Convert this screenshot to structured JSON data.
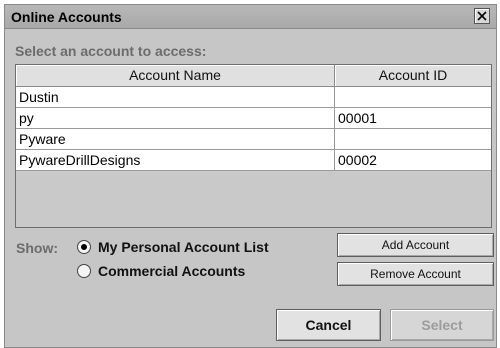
{
  "window": {
    "title": "Online Accounts"
  },
  "prompt": "Select an account to access:",
  "table": {
    "columns": [
      "Account Name",
      "Account ID"
    ],
    "rows": [
      {
        "name": "Dustin",
        "id": ""
      },
      {
        "name": "py",
        "id": "00001"
      },
      {
        "name": "Pyware",
        "id": ""
      },
      {
        "name": "PywareDrillDesigns",
        "id": "00002"
      }
    ]
  },
  "show": {
    "label": "Show:",
    "options": [
      {
        "label": "My Personal Account List",
        "selected": true
      },
      {
        "label": "Commercial Accounts",
        "selected": false
      }
    ]
  },
  "buttons": {
    "add": "Add Account",
    "remove": "Remove Account",
    "cancel": "Cancel",
    "select": "Select"
  },
  "icons": {
    "close": "close-icon"
  }
}
